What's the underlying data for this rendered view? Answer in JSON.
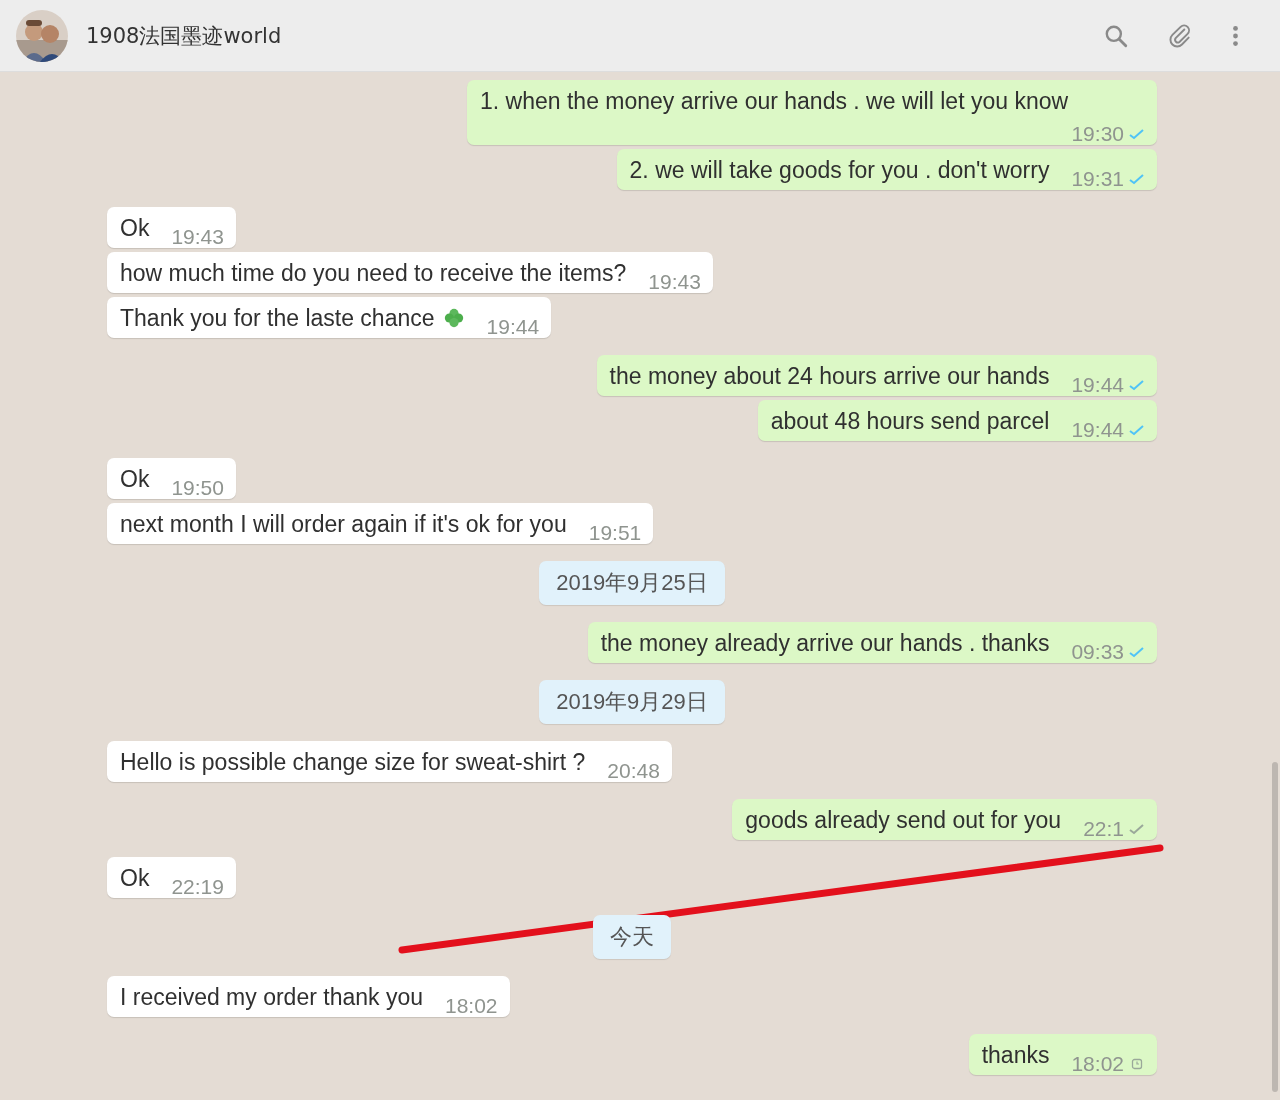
{
  "header": {
    "title": "1908法国墨迹world"
  },
  "messages": [
    {
      "kind": "message",
      "outgoing": true,
      "text": "1. when the money arrive our hands . we will let you know",
      "time": "19:30",
      "read": true
    },
    {
      "kind": "message",
      "outgoing": true,
      "text": "2. we will take goods for you . don't worry",
      "time": "19:31",
      "read": true
    },
    {
      "kind": "message",
      "outgoing": false,
      "text": "Ok",
      "time": "19:43"
    },
    {
      "kind": "message",
      "outgoing": false,
      "text": "how much time do you need to receive the items?",
      "time": "19:43"
    },
    {
      "kind": "message",
      "outgoing": false,
      "text": "Thank you for the laste chance",
      "has_emoji": true,
      "time": "19:44"
    },
    {
      "kind": "message",
      "outgoing": true,
      "text": "the money about 24 hours arrive our hands",
      "time": "19:44",
      "read": true
    },
    {
      "kind": "message",
      "outgoing": true,
      "text": "about 48 hours send parcel",
      "time": "19:44",
      "read": true
    },
    {
      "kind": "message",
      "outgoing": false,
      "text": "Ok",
      "time": "19:50"
    },
    {
      "kind": "message",
      "outgoing": false,
      "text": "next month I will order again if it's ok for you",
      "time": "19:51"
    },
    {
      "kind": "date",
      "text": "2019年9月25日"
    },
    {
      "kind": "message",
      "outgoing": true,
      "text": "the money already arrive our hands . thanks",
      "time": "09:33",
      "read": true
    },
    {
      "kind": "date",
      "text": "2019年9月29日"
    },
    {
      "kind": "message",
      "outgoing": false,
      "text": "Hello is possible change size for sweat-shirt ?",
      "time": "20:48"
    },
    {
      "kind": "message",
      "outgoing": true,
      "text": "goods already send out for you",
      "time": "22:1",
      "read": false
    },
    {
      "kind": "message",
      "outgoing": false,
      "text": "Ok",
      "time": "22:19"
    },
    {
      "kind": "date",
      "text": "今天"
    },
    {
      "kind": "message",
      "outgoing": false,
      "text": "I received my order thank you",
      "time": "18:02"
    },
    {
      "kind": "message",
      "outgoing": true,
      "text": "thanks",
      "time": "18:02",
      "pending": true
    }
  ]
}
